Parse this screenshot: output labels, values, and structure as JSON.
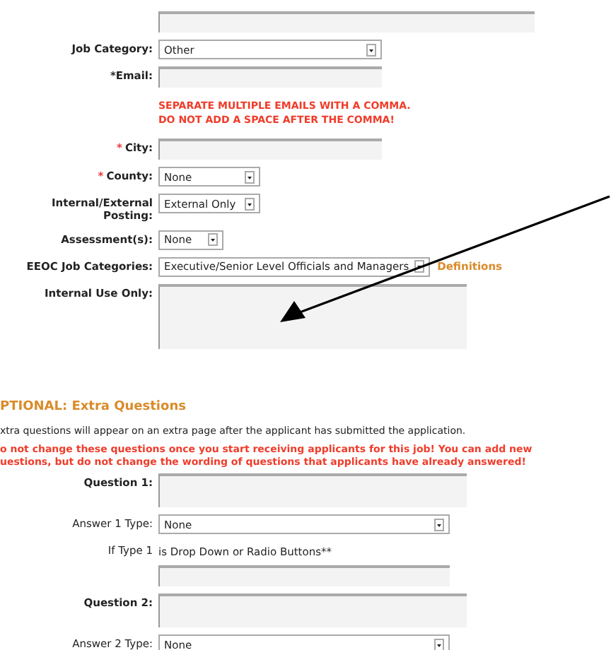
{
  "job_fields": [
    {
      "kind": "input"
    },
    {
      "kind": "select",
      "label": "Job Category:",
      "value": "Other"
    },
    {
      "kind": "input",
      "label": "*Email:"
    },
    {
      "kind": "note",
      "lines": [
        "SEPARATE MULTIPLE EMAILS WITH A COMMA.",
        "DO NOT ADD A SPACE AFTER THE COMMA!"
      ]
    },
    {
      "kind": "input",
      "required_mark": "*",
      "label": "City:"
    },
    {
      "kind": "select",
      "required_mark": "*",
      "label": "County:",
      "value": "None"
    },
    {
      "kind": "select",
      "label": "Internal/External Posting:",
      "value": "External Only"
    },
    {
      "kind": "select",
      "label": "Assessment(s):",
      "value": "None"
    },
    {
      "kind": "select",
      "label": "EEOC Job Categories:",
      "value": "Executive/Senior Level Officials and Managers",
      "link": "Definitions"
    },
    {
      "kind": "textarea",
      "label": "Internal Use Only:"
    }
  ],
  "extra_section": {
    "title": "PTIONAL: Extra Questions",
    "description": "xtra questions will appear on an extra page after the applicant has submitted the application.",
    "warning": [
      "o not change these questions once you start receiving applicants for this job! You can add new",
      "uestions, but do not change the wording of questions that applicants have already answered!"
    ],
    "fields": [
      {
        "kind": "textarea",
        "label": "Question 1:",
        "bold": true
      },
      {
        "kind": "select",
        "label": "Answer 1 Type:",
        "bold": false,
        "value": "None"
      },
      {
        "kind": "hint",
        "label": "If Type 1",
        "text": "is Drop Down or Radio Buttons**"
      },
      {
        "kind": "input"
      },
      {
        "kind": "textarea",
        "label": "Question 2:",
        "bold": true
      },
      {
        "kind": "select",
        "label": "Answer 2 Type:",
        "bold": false,
        "value": "None"
      }
    ]
  }
}
